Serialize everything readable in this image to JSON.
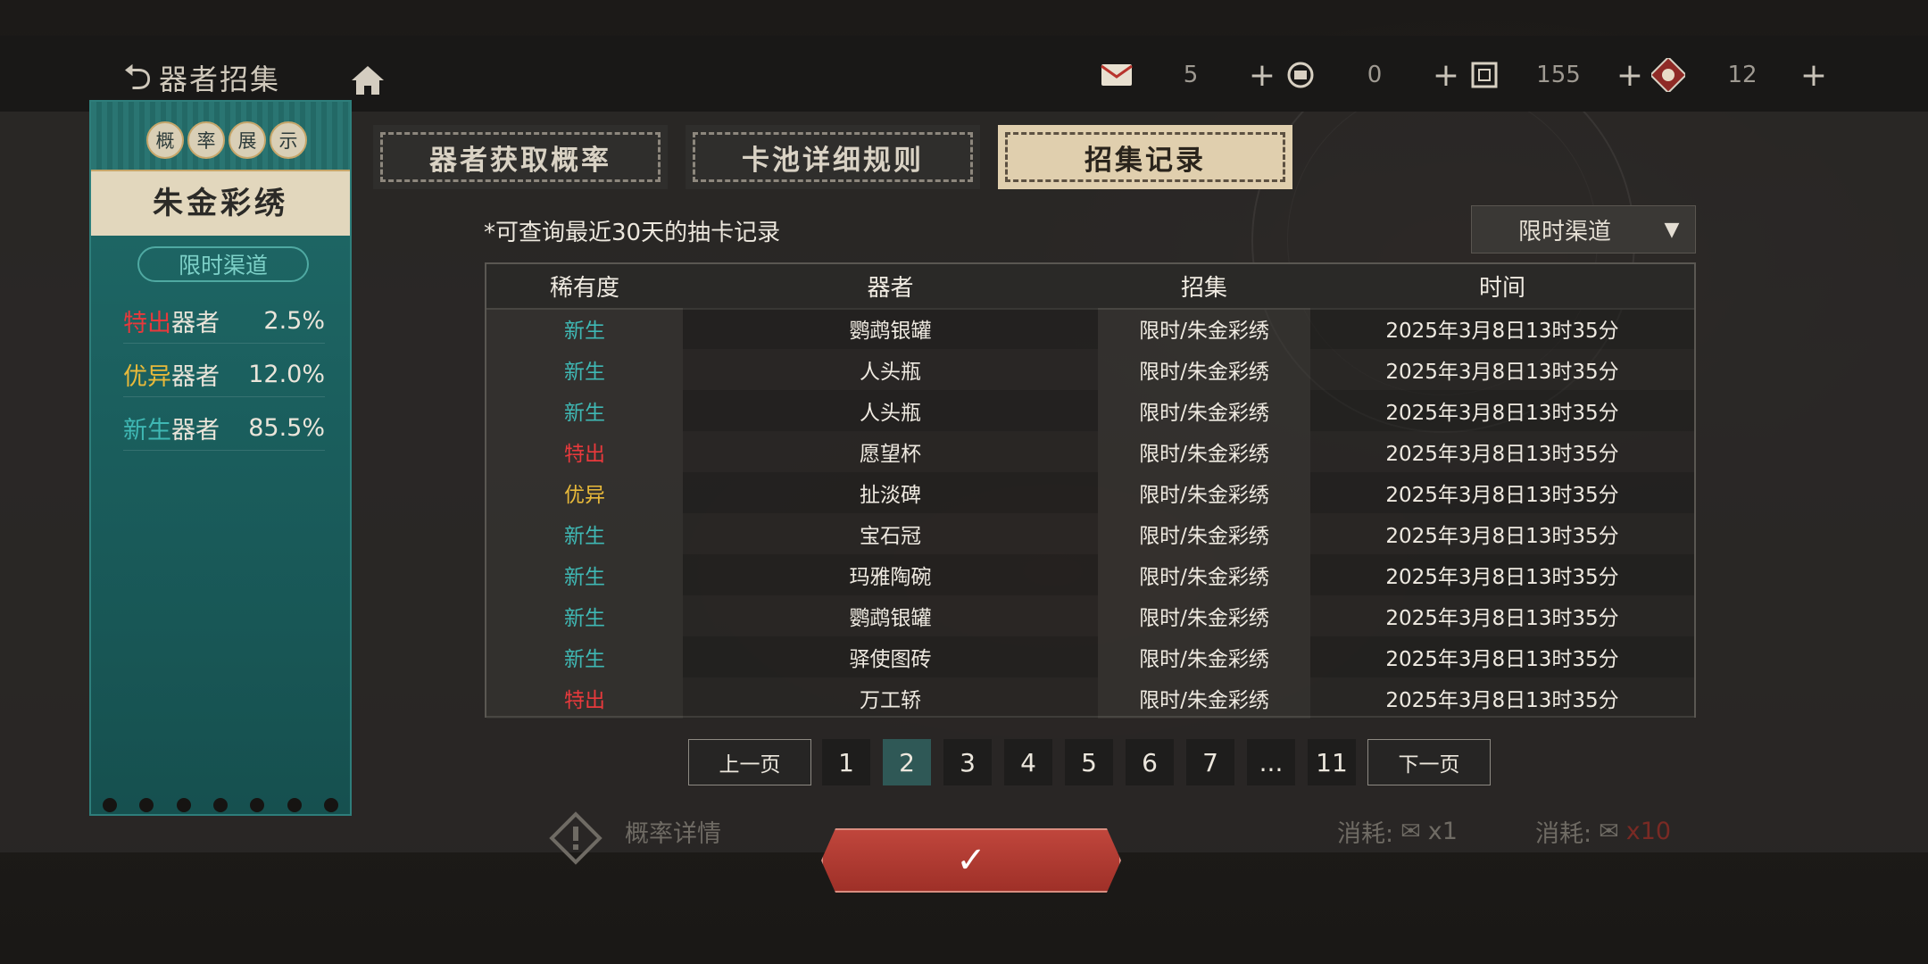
{
  "topbar": {
    "back_label": "器者招集",
    "resources": [
      {
        "icon": "envelope-icon",
        "value": "5"
      },
      {
        "icon": "scroll-icon",
        "value": "0"
      },
      {
        "icon": "ticket-icon",
        "value": "155"
      },
      {
        "icon": "badge-icon",
        "value": "12"
      }
    ],
    "plus": "+"
  },
  "sidebar": {
    "badges": [
      "概",
      "率",
      "展",
      "示"
    ],
    "pool_name": "朱金彩绣",
    "channel": "限时渠道",
    "rates": [
      {
        "tier": "特出",
        "kind": "器者",
        "pct": "2.5%",
        "color": "#e8393c"
      },
      {
        "tier": "优异",
        "kind": "器者",
        "pct": "12.0%",
        "color": "#e8b93a"
      },
      {
        "tier": "新生",
        "kind": "器者",
        "pct": "85.5%",
        "color": "#3fb8b4"
      }
    ]
  },
  "tabs": [
    {
      "label": "器者获取概率",
      "active": false
    },
    {
      "label": "卡池详细规则",
      "active": false
    },
    {
      "label": "招集记录",
      "active": true
    }
  ],
  "note": "*可查询最近30天的抽卡记录",
  "dropdown": {
    "selected": "限时渠道"
  },
  "table": {
    "headers": [
      "稀有度",
      "器者",
      "招集",
      "时间"
    ],
    "rows": [
      {
        "rarity": "新生",
        "name": "鹦鹉银罐",
        "channel": "限时/朱金彩绣",
        "time": "2025年3月8日13时35分"
      },
      {
        "rarity": "新生",
        "name": "人头瓶",
        "channel": "限时/朱金彩绣",
        "time": "2025年3月8日13时35分"
      },
      {
        "rarity": "新生",
        "name": "人头瓶",
        "channel": "限时/朱金彩绣",
        "time": "2025年3月8日13时35分"
      },
      {
        "rarity": "特出",
        "name": "愿望杯",
        "channel": "限时/朱金彩绣",
        "time": "2025年3月8日13时35分"
      },
      {
        "rarity": "优异",
        "name": "扯淡碑",
        "channel": "限时/朱金彩绣",
        "time": "2025年3月8日13时35分"
      },
      {
        "rarity": "新生",
        "name": "宝石冠",
        "channel": "限时/朱金彩绣",
        "time": "2025年3月8日13时35分"
      },
      {
        "rarity": "新生",
        "name": "玛雅陶碗",
        "channel": "限时/朱金彩绣",
        "time": "2025年3月8日13时35分"
      },
      {
        "rarity": "新生",
        "name": "鹦鹉银罐",
        "channel": "限时/朱金彩绣",
        "time": "2025年3月8日13时35分"
      },
      {
        "rarity": "新生",
        "name": "驿使图砖",
        "channel": "限时/朱金彩绣",
        "time": "2025年3月8日13时35分"
      },
      {
        "rarity": "特出",
        "name": "万工轿",
        "channel": "限时/朱金彩绣",
        "time": "2025年3月8日13时35分"
      }
    ]
  },
  "rarity_colors": {
    "特出": "#e8393c",
    "优异": "#e8b93a",
    "新生": "#3fb8b4"
  },
  "pager": {
    "prev": "上一页",
    "next": "下一页",
    "pages": [
      "1",
      "2",
      "3",
      "4",
      "5",
      "6",
      "7",
      "...",
      "11"
    ],
    "current": "2"
  },
  "confirm": {
    "icon": "check-icon"
  },
  "background": {
    "rate_detail": "概率详情",
    "cost_single": "消耗:",
    "cost_single_count": "x1",
    "cost_multi": "消耗:",
    "cost_multi_count": "x10"
  }
}
